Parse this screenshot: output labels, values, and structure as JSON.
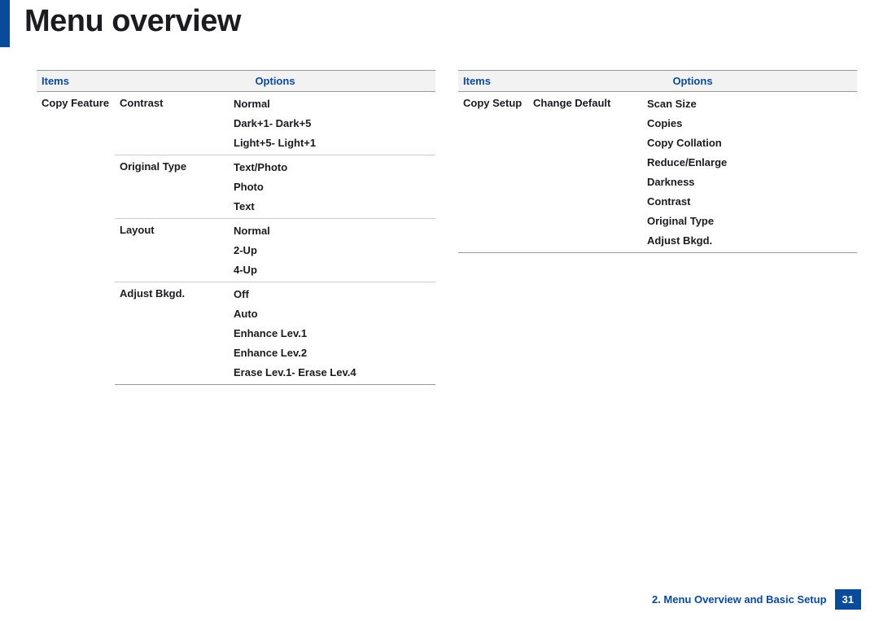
{
  "title": "Menu overview",
  "footer": {
    "section": "2.  Menu Overview and Basic Setup",
    "page": "31"
  },
  "table_left": {
    "headers": {
      "items": "Items",
      "options": "Options"
    },
    "parent": "Copy Feature",
    "groups": [
      {
        "name": "Contrast",
        "options": [
          "Normal",
          "Dark+1- Dark+5",
          "Light+5- Light+1"
        ]
      },
      {
        "name": "Original Type",
        "options": [
          "Text/Photo",
          "Photo",
          "Text"
        ]
      },
      {
        "name": "Layout",
        "options": [
          "Normal",
          "2-Up",
          "4-Up"
        ]
      },
      {
        "name": "Adjust Bkgd.",
        "options": [
          "Off",
          "Auto",
          "Enhance Lev.1",
          "Enhance Lev.2",
          "Erase Lev.1- Erase Lev.4"
        ]
      }
    ]
  },
  "table_right": {
    "headers": {
      "items": "Items",
      "options": "Options"
    },
    "parent": "Copy Setup",
    "groups": [
      {
        "name": "Change Default",
        "options": [
          "Scan Size",
          "Copies",
          "Copy Collation",
          "Reduce/Enlarge",
          "Darkness",
          "Contrast",
          "Original Type",
          "Adjust Bkgd."
        ]
      }
    ]
  }
}
